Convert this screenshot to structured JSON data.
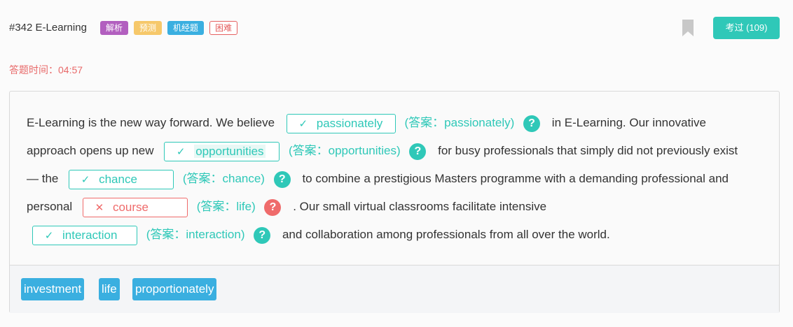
{
  "header": {
    "question_id": "#342 E-Learning",
    "tags": [
      "解析",
      "预测",
      "机经题",
      "困难"
    ],
    "done_button": "考过 (109)",
    "bookmark_icon": "bookmark-icon"
  },
  "timer": "答题时间：04:57",
  "passage": {
    "l1_text1": "E-Learning is the new way forward. We believe",
    "b1_value": "passionately",
    "b1_answer": "(答案：passionately)",
    "l1_text2": "in E-Learning. Our innovative",
    "l2_text1": "approach opens up new",
    "b2_value": "opportunities",
    "b2_answer": "(答案：opportunities)",
    "l2_text2": "for busy professionals that simply did not previously exist",
    "l3_text1": "— the",
    "b3_value": "chance",
    "b3_answer": "(答案：chance)",
    "l3_text2": "to combine a prestigious Masters programme with a demanding professional and",
    "l4_text1": "personal",
    "b4_value": "course",
    "b4_answer": "(答案：life)",
    "l4_text2": ". Our small virtual classrooms facilitate intensive",
    "b5_value": "interaction",
    "b5_answer": "(答案：interaction)",
    "l5_text2": "and collaboration among professionals from all over the world.",
    "correct_mark": "✓",
    "wrong_mark": "✕",
    "help_glyph": "?"
  },
  "options": [
    "investment",
    "life",
    "proportionately"
  ],
  "colors": {
    "accent": "#2fc8b8",
    "error": "#ef6b6b",
    "option_bg": "#3aafe0"
  }
}
